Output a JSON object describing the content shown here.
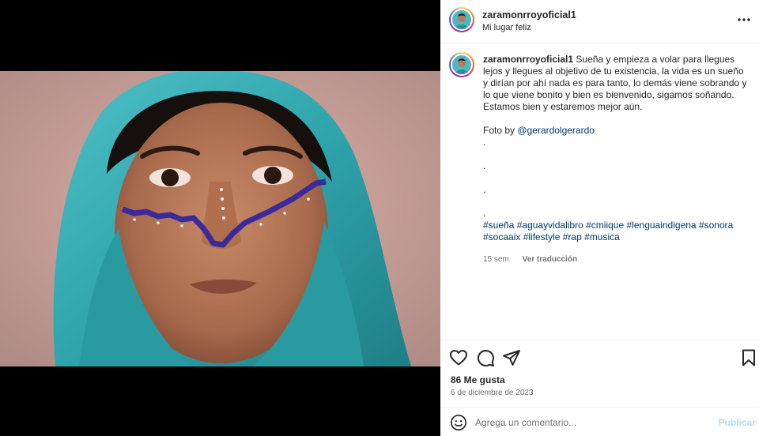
{
  "post": {
    "username": "zaramonrroyoficial1",
    "location": "Mi lugar feliz",
    "photo_alt_icon": "portrait-photo"
  },
  "caption": {
    "username": "zaramonrroyoficial1",
    "text": "Sueña y empieza a volar para llegues lejos y llegues al objetivo de tu existencia, la vida es un sueño y dirían por ahí nada es para tanto, lo demás viene sobrando y lo que viene bonito y bien es bienvenido, sigamos soñando. Estamos bien y estaremos mejor aún.",
    "photo_credit_prefix": "Foto by",
    "photo_credit_handle": "@gerardolgerardo",
    "dots": [
      ".",
      ".",
      ".",
      "."
    ],
    "hashtags": [
      "#sueña",
      "#aguayvidalibro",
      "#cmiique",
      "#lenguaindigena",
      "#sonora",
      "#socaaix",
      "#lifestyle",
      "#rap",
      "#musica"
    ],
    "time_ago": "15 sem",
    "translate_label": "Ver traducción"
  },
  "actions": {
    "like_icon": "heart-icon",
    "comment_icon": "comment-icon",
    "share_icon": "send-icon",
    "save_icon": "bookmark-icon"
  },
  "stats": {
    "likes": "86 Me gusta",
    "date": "6 de diciembre de 2023"
  },
  "comment_box": {
    "placeholder": "Agrega un comentario...",
    "publish_label": "Publicar",
    "emoji_icon": "emoji-icon"
  },
  "colors": {
    "link": "#00376b",
    "publish_disabled": "#b3dbff",
    "scarf": "#3fb3b8",
    "face_paint": "#3a2a9a"
  }
}
